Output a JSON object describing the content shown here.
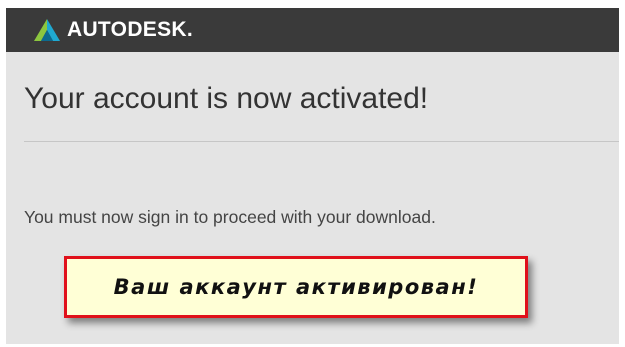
{
  "header": {
    "brand": "AUTODESK.",
    "logo_icon": "autodesk-logo-icon",
    "background": "#3a3a3a",
    "logo_colors": [
      "#8cc63f",
      "#1fa9d1",
      "#0c6a8f"
    ]
  },
  "content": {
    "title": "Your account is now activated!",
    "message": "You must now sign in to proceed with your download."
  },
  "annotation": {
    "text": "Ваш аккаунт активирован!",
    "border_color": "#e0101a",
    "background": "#ffffd6"
  }
}
